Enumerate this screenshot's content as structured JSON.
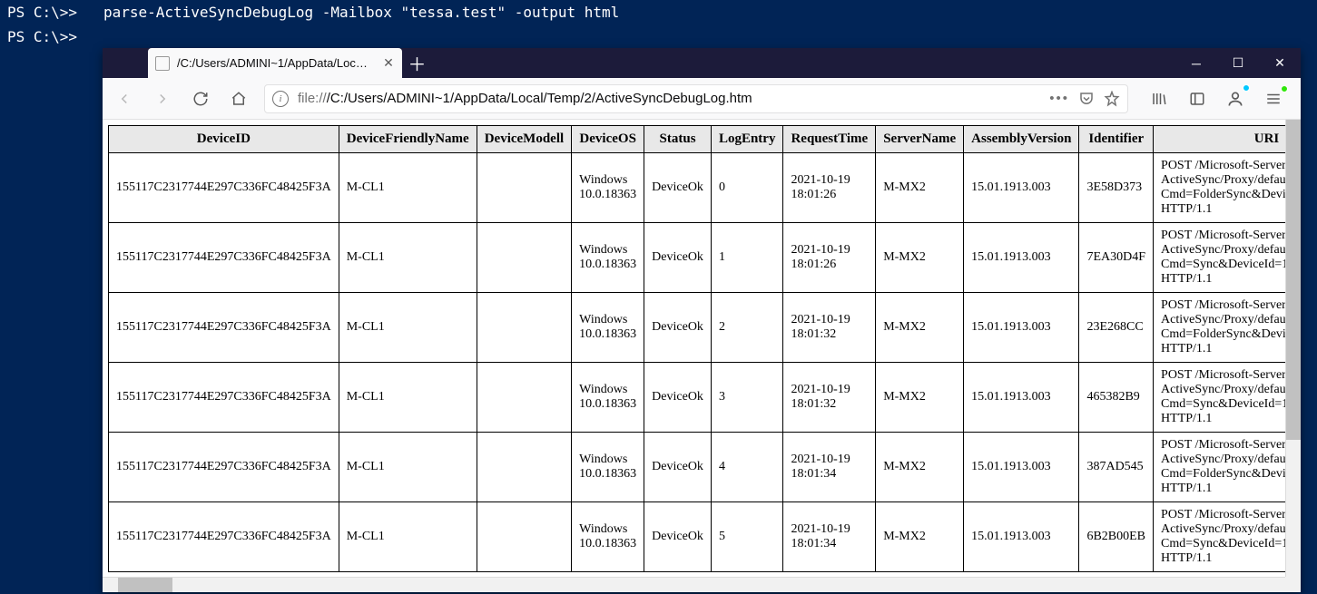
{
  "terminal": {
    "prompt1": "PS C:\\>>",
    "command": "parse-ActiveSyncDebugLog -Mailbox \"tessa.test\" -output html",
    "prompt2": "PS C:\\>>"
  },
  "browser": {
    "tab_label": "/C:/Users/ADMINI~1/AppData/Loc…",
    "url_prefix": "file://",
    "url_path": "/C:/Users/ADMINI~1/AppData/Local/Temp/2/ActiveSyncDebugLog.htm",
    "table": {
      "headers": [
        "DeviceID",
        "DeviceFriendlyName",
        "DeviceModell",
        "DeviceOS",
        "Status",
        "LogEntry",
        "RequestTime",
        "ServerName",
        "AssemblyVersion",
        "Identifier",
        "URI"
      ],
      "rows": [
        {
          "DeviceID": "155117C2317744E297C336FC48425F3A",
          "DeviceFriendlyName": "M-CL1",
          "DeviceModell": "",
          "DeviceOS": "Windows 10.0.18363",
          "Status": "DeviceOk",
          "LogEntry": "0",
          "RequestTime": "2021-10-19 18:01:26",
          "ServerName": "M-MX2",
          "AssemblyVersion": "15.01.1913.003",
          "Identifier": "3E58D373",
          "URI": "POST /Microsoft-Server-ActiveSync/Proxy/default.eas?Cmd=FolderSync&DeviceId=155117C2317744E297C336FC48425F3A&DeviceType=WindowsMail HTTP/1.1"
        },
        {
          "DeviceID": "155117C2317744E297C336FC48425F3A",
          "DeviceFriendlyName": "M-CL1",
          "DeviceModell": "",
          "DeviceOS": "Windows 10.0.18363",
          "Status": "DeviceOk",
          "LogEntry": "1",
          "RequestTime": "2021-10-19 18:01:26",
          "ServerName": "M-MX2",
          "AssemblyVersion": "15.01.1913.003",
          "Identifier": "7EA30D4F",
          "URI": "POST /Microsoft-Server-ActiveSync/Proxy/default.eas?Cmd=Sync&DeviceId=155117C2317744E297C336FC48425F3A&DeviceType=WindowsMail HTTP/1.1"
        },
        {
          "DeviceID": "155117C2317744E297C336FC48425F3A",
          "DeviceFriendlyName": "M-CL1",
          "DeviceModell": "",
          "DeviceOS": "Windows 10.0.18363",
          "Status": "DeviceOk",
          "LogEntry": "2",
          "RequestTime": "2021-10-19 18:01:32",
          "ServerName": "M-MX2",
          "AssemblyVersion": "15.01.1913.003",
          "Identifier": "23E268CC",
          "URI": "POST /Microsoft-Server-ActiveSync/Proxy/default.eas?Cmd=FolderSync&DeviceId=155117C2317744E297C336FC48425F3A&DeviceType=WindowsMail HTTP/1.1"
        },
        {
          "DeviceID": "155117C2317744E297C336FC48425F3A",
          "DeviceFriendlyName": "M-CL1",
          "DeviceModell": "",
          "DeviceOS": "Windows 10.0.18363",
          "Status": "DeviceOk",
          "LogEntry": "3",
          "RequestTime": "2021-10-19 18:01:32",
          "ServerName": "M-MX2",
          "AssemblyVersion": "15.01.1913.003",
          "Identifier": "465382B9",
          "URI": "POST /Microsoft-Server-ActiveSync/Proxy/default.eas?Cmd=Sync&DeviceId=155117C2317744E297C336FC48425F3A&DeviceType=WindowsMail HTTP/1.1"
        },
        {
          "DeviceID": "155117C2317744E297C336FC48425F3A",
          "DeviceFriendlyName": "M-CL1",
          "DeviceModell": "",
          "DeviceOS": "Windows 10.0.18363",
          "Status": "DeviceOk",
          "LogEntry": "4",
          "RequestTime": "2021-10-19 18:01:34",
          "ServerName": "M-MX2",
          "AssemblyVersion": "15.01.1913.003",
          "Identifier": "387AD545",
          "URI": "POST /Microsoft-Server-ActiveSync/Proxy/default.eas?Cmd=FolderSync&DeviceId=155117C2317744E297C336FC48425F3A&DeviceType=WindowsMail HTTP/1.1"
        },
        {
          "DeviceID": "155117C2317744E297C336FC48425F3A",
          "DeviceFriendlyName": "M-CL1",
          "DeviceModell": "",
          "DeviceOS": "Windows 10.0.18363",
          "Status": "DeviceOk",
          "LogEntry": "5",
          "RequestTime": "2021-10-19 18:01:34",
          "ServerName": "M-MX2",
          "AssemblyVersion": "15.01.1913.003",
          "Identifier": "6B2B00EB",
          "URI": "POST /Microsoft-Server-ActiveSync/Proxy/default.eas?Cmd=Sync&DeviceId=155117C2317744E297C336FC48425F3A&DeviceType=WindowsMail HTTP/1.1"
        }
      ]
    }
  }
}
